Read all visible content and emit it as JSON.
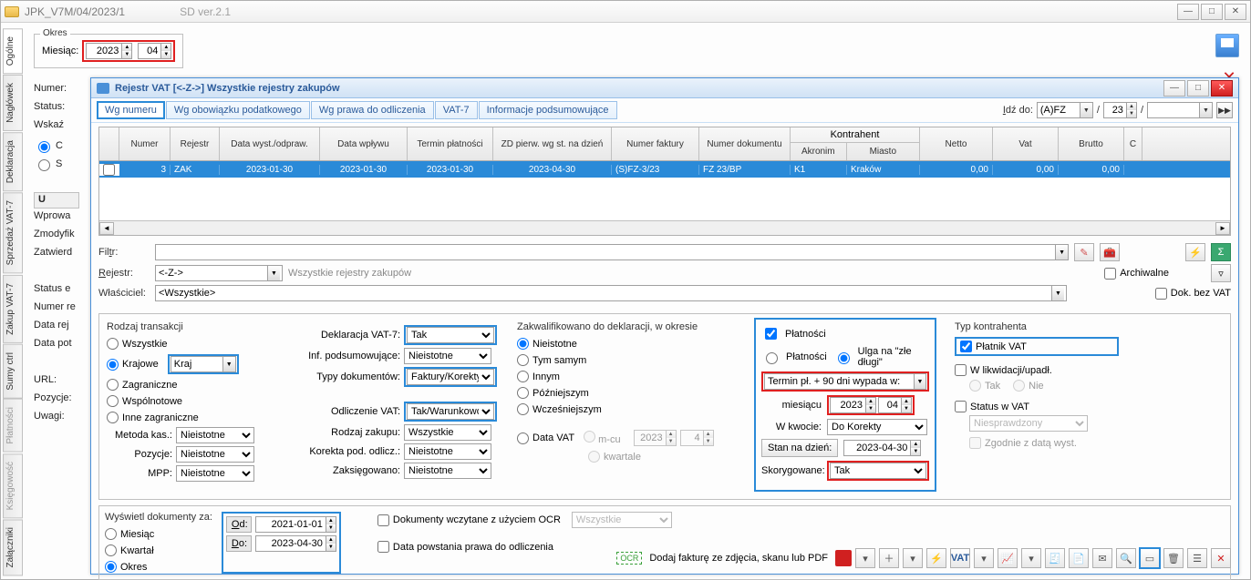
{
  "outer": {
    "title": "JPK_V7M/04/2023/1",
    "subtitle": "SD ver.2.1",
    "period_legend": "Okres",
    "month_label": "Miesiąc:",
    "year": "2023",
    "month": "04"
  },
  "side_tabs": [
    "Ogólne",
    "Nagłówek",
    "Deklaracja",
    "Sprzedaż VAT-7",
    "Zakup VAT-7",
    "Sumy ctrl",
    "Płatności",
    "Księgowość",
    "Załączniki"
  ],
  "outer_left_labels": [
    "Numer:",
    "Status:",
    "Wskaź",
    "",
    "",
    "",
    "U",
    "Wprowa",
    "Zmodyfik",
    "Zatwierd",
    "",
    "Status e",
    "Numer re",
    "Data rej",
    "Data pot",
    "",
    "URL:",
    "Pozycje:",
    "Uwagi:"
  ],
  "outer_left_radios": [
    "C",
    "S"
  ],
  "inner": {
    "title": "Rejestr VAT   [<-Z->]   Wszystkie rejestry zakupów",
    "tabs": [
      "Wg numeru",
      "Wg obowiązku podatkowego",
      "Wg prawa do odliczenia",
      "VAT-7",
      "Informacje podsumowujące"
    ],
    "goto_label": "Idź do:",
    "goto_sel": "(A)FZ",
    "goto_page": "23",
    "grid": {
      "headers": [
        "",
        "Numer",
        "Rejestr",
        "Data wyst./odpraw.",
        "Data wpływu",
        "Termin płatności",
        "ZD pierw. wg st. na dzień",
        "Numer faktury",
        "Numer dokumentu",
        "Akronim",
        "Miasto",
        "Netto",
        "Vat",
        "Brutto",
        "C"
      ],
      "kontrahent_group": "Kontrahent",
      "row": [
        "",
        "3",
        "ZAK",
        "2023-01-30",
        "2023-01-30",
        "2023-01-30",
        "2023-04-30",
        "(S)FZ-3/23",
        "FZ 23/BP",
        "K1",
        "Kraków",
        "0,00",
        "0,00",
        "0,00",
        ""
      ]
    },
    "filter_label": "Filtr:",
    "rejestr_label": "Rejestr:",
    "rejestr_val": "<-Z->",
    "rejestr_desc": "Wszystkie rejestry zakupów",
    "wlasciciel_label": "Właściciel:",
    "wlasciciel_val": "<Wszystkie>",
    "archiwalne": "Archiwalne",
    "dok_bez_vat": "Dok. bez VAT",
    "rodzaj_trans": {
      "title": "Rodzaj transakcji",
      "opts": [
        "Wszystkie",
        "Krajowe",
        "Zagraniczne",
        "Wspólnotowe",
        "Inne zagraniczne"
      ],
      "kraj_sel": "Kraj",
      "metoda_kas": "Metoda kas.:",
      "metoda_kas_v": "Nieistotne",
      "pozycje": "Pozycje:",
      "pozycje_v": "Nieistotne",
      "mpp": "MPP:",
      "mpp_v": "Nieistotne"
    },
    "col2": {
      "dekl": "Deklaracja VAT-7:",
      "dekl_v": "Tak",
      "inf": "Inf. podsumowujące:",
      "inf_v": "Nieistotne",
      "typy": "Typy dokumentów:",
      "typy_v": "Faktury/Korekty",
      "odl": "Odliczenie VAT:",
      "odl_v": "Tak/Warunkowo",
      "rodz": "Rodzaj zakupu:",
      "rodz_v": "Wszystkie",
      "kor": "Korekta pod. odlicz.:",
      "kor_v": "Nieistotne",
      "zak": "Zaksięgowano:",
      "zak_v": "Nieistotne"
    },
    "col3": {
      "title": "Zakwalifikowano do deklaracji, w okresie",
      "opts": [
        "Nieistotne",
        "Tym samym",
        "Innym",
        "Późniejszym",
        "Wcześniejszym"
      ],
      "datavat": "Data VAT",
      "mcu": "m-cu",
      "kwartale": "kwartale",
      "yr": "2023",
      "mn": "4"
    },
    "pay": {
      "pl_chk": "Płatności",
      "r1": "Płatności",
      "r2": "Ulga na \"złe długi\"",
      "termin": "Termin pł. + 90 dni wypada w:",
      "miesiacu": "miesiącu",
      "yr": "2023",
      "mn": "04",
      "wkwocie": "W kwocie:",
      "wkwocie_v": "Do Korekty",
      "stan": "Stan na dzień:",
      "stan_v": "2023-04-30",
      "skor": "Skorygowane:",
      "skor_v": "Tak"
    },
    "typ": {
      "title": "Typ kontrahenta",
      "platnik": "Płatnik VAT",
      "likw": "W likwidacji/upadł.",
      "tak": "Tak",
      "nie": "Nie",
      "status": "Status w VAT",
      "status_v": "Niesprawdzony",
      "zgod": "Zgodnie z datą wyst."
    },
    "dates": {
      "title": "Wyświetl dokumenty za:",
      "opts": [
        "Miesiąc",
        "Kwartał",
        "Okres"
      ],
      "od": "Od:",
      "od_v": "2021-01-01",
      "do": "Do:",
      "do_v": "2023-04-30",
      "ocr_chk": "Dokumenty wczytane z użyciem OCR",
      "ocr_sel": "Wszystkie",
      "data_powst": "Data powstania prawa do odliczenia"
    },
    "bottom": {
      "ocr": "OCR",
      "add_text": "Dodaj fakturę ze zdjęcia, skanu lub PDF"
    }
  }
}
